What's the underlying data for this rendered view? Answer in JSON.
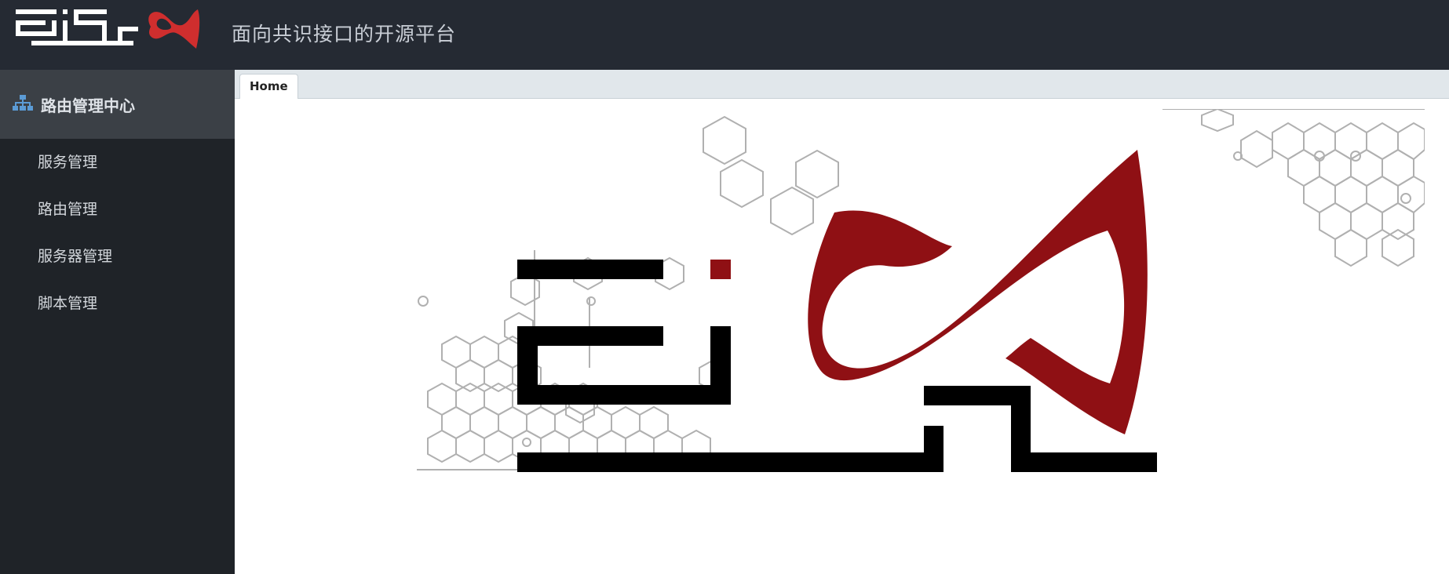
{
  "header": {
    "subtitle": "面向共识接口的开源平台",
    "logo_icon": "eisl-logo"
  },
  "sidebar": {
    "section_title": "路由管理中心",
    "section_icon": "sitemap-icon",
    "items": [
      {
        "label": "服务管理"
      },
      {
        "label": "路由管理"
      },
      {
        "label": "服务器管理"
      },
      {
        "label": "脚本管理"
      }
    ]
  },
  "tabs": [
    {
      "label": "Home",
      "active": true
    }
  ],
  "colors": {
    "header_bg": "#252a33",
    "sidebar_bg": "#1f2328",
    "brand_red": "#8f1014",
    "logo_red": "#cf2e2e"
  },
  "hero_icon": "eisl-hero-logo"
}
